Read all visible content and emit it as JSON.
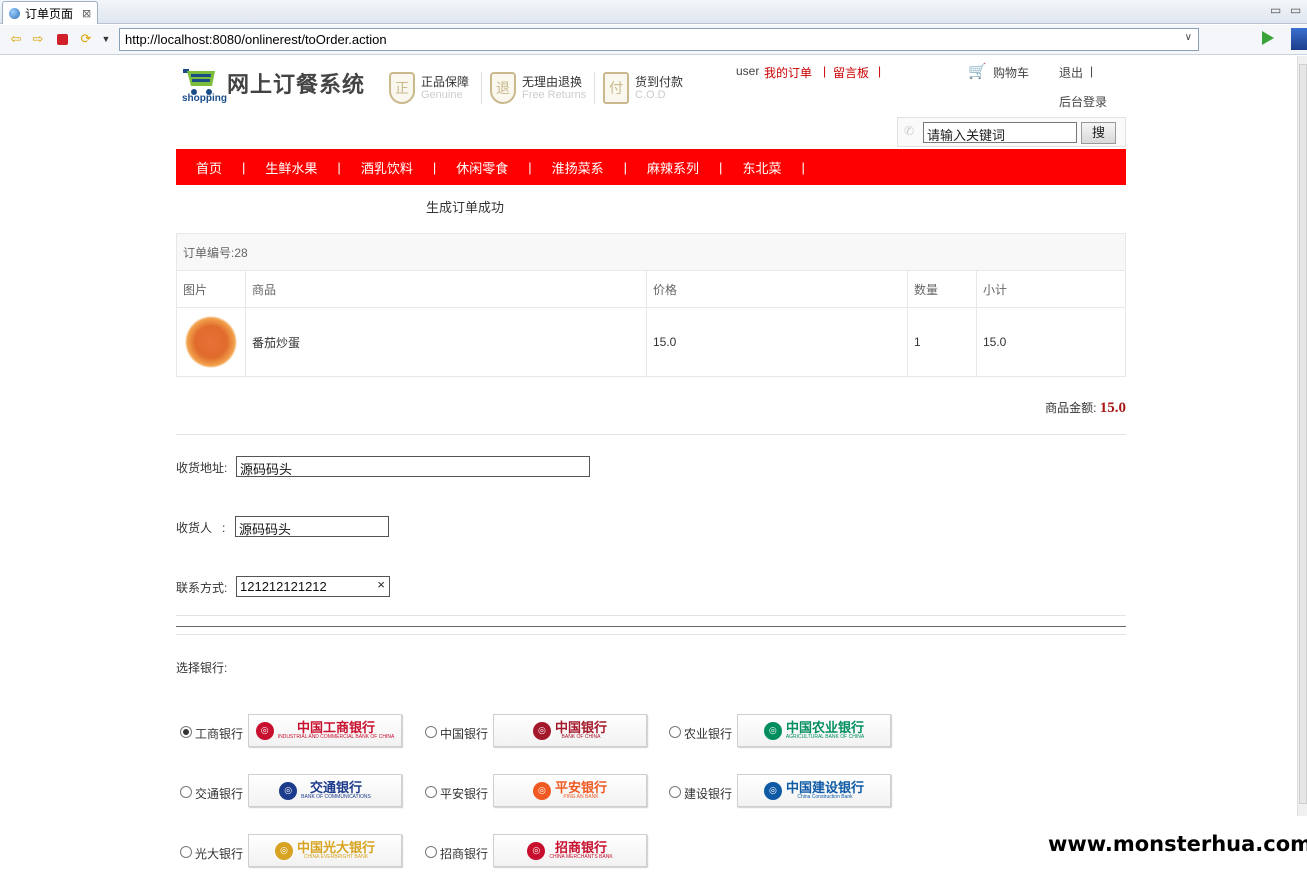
{
  "browser": {
    "tab_title": "订单页面",
    "url": "http://localhost:8080/onlinerest/toOrder.action"
  },
  "header": {
    "site_title": "网上订餐系统",
    "logo_sub": "shopping",
    "badges": [
      {
        "title": "正品保障",
        "sub": "Genuine",
        "icon": "正"
      },
      {
        "title": "无理由退换",
        "sub": "Free Returns",
        "icon": "退"
      },
      {
        "title": "货到付款",
        "sub": "C.O.D",
        "icon": "付"
      }
    ],
    "user": "user",
    "my_orders": "我的订单",
    "message_board": "留言板",
    "sep": "|",
    "cart": "购物车",
    "logout": "退出",
    "admin_login": "后台登录",
    "search_placeholder": "请输入关键词",
    "search_button": "搜"
  },
  "nav": [
    "首页",
    "生鲜水果",
    "酒乳饮料",
    "休闲零食",
    "淮扬菜系",
    "麻辣系列",
    "东北菜"
  ],
  "order": {
    "success_msg": "生成订单成功",
    "order_no_label": "订单编号:28",
    "columns": [
      "图片",
      "商品",
      "价格",
      "数量",
      "小计"
    ],
    "items": [
      {
        "name": "番茄炒蛋",
        "price": "15.0",
        "qty": "1",
        "subtotal": "15.0"
      }
    ],
    "total_label": "商品金额:",
    "total_value": "15.0"
  },
  "form": {
    "address_label": "收货地址:",
    "address_value": "源码码头",
    "receiver_label": "收货人   :",
    "receiver_value": "源码码头",
    "phone_label": "联系方式:",
    "phone_value": "121212121212",
    "clear_icon": "×",
    "bank_label": "选择银行:"
  },
  "banks": [
    {
      "label": "工商银行",
      "logo": "中国工商银行",
      "sub": "INDUSTRIAL AND COMMERCIAL BANK OF CHINA",
      "color": "#c8102e",
      "checked": true
    },
    {
      "label": "中国银行",
      "logo": "中国银行",
      "sub": "BANK OF CHINA",
      "color": "#a3182b",
      "checked": false
    },
    {
      "label": "农业银行",
      "logo": "中国农业银行",
      "sub": "AGRICULTURAL BANK OF CHINA",
      "color": "#008e5e",
      "checked": false
    },
    {
      "label": "交通银行",
      "logo": "交通银行",
      "sub": "BANK OF COMMUNICATIONS",
      "color": "#1d3b8b",
      "checked": false
    },
    {
      "label": "平安银行",
      "logo": "平安银行",
      "sub": "PING AN BANK",
      "color": "#f05a22",
      "checked": false
    },
    {
      "label": "建设银行",
      "logo": "中国建设银行",
      "sub": "China Construction Bank",
      "color": "#0f5aa5",
      "checked": false
    },
    {
      "label": "光大银行",
      "logo": "中国光大银行",
      "sub": "CHINA EVERBRIGHT BANK",
      "color": "#d7a321",
      "checked": false
    },
    {
      "label": "招商银行",
      "logo": "招商银行",
      "sub": "CHINA MERCHANTS BANK",
      "color": "#c8102e",
      "checked": false
    }
  ],
  "watermark": "www.monsterhua.com"
}
